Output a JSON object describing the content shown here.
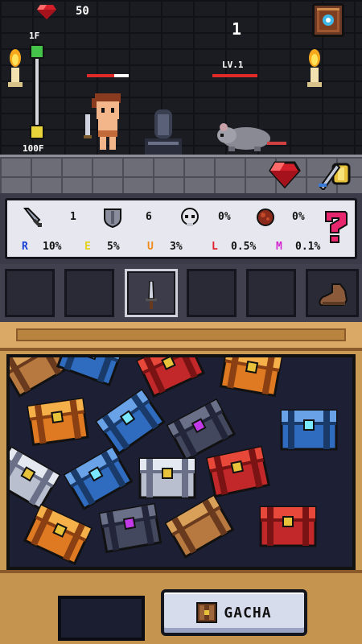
{
  "hud": {
    "gems": "50",
    "score": "1",
    "floor_top": "1F",
    "floor_bottom": "100F"
  },
  "enemy": {
    "level": "LV.1"
  },
  "stats": {
    "attack": "1",
    "defense": "6",
    "crit": "0%",
    "luck": "0%",
    "rarities": [
      {
        "letter": "R",
        "value": "10%",
        "color": "#1a3fd6"
      },
      {
        "letter": "E",
        "value": "5%",
        "color": "#e4d21a"
      },
      {
        "letter": "U",
        "value": "3%",
        "color": "#f08a1a"
      },
      {
        "letter": "L",
        "value": "0.5%",
        "color": "#e0202a"
      },
      {
        "letter": "M",
        "value": "0.1%",
        "color": "#d426d0"
      }
    ]
  },
  "gacha": {
    "button_label": "GACHA"
  },
  "icons": {
    "gem": "ruby-gem-icon",
    "spellbook": "spellbook-icon",
    "sword": "sword-icon",
    "shield": "shield-icon",
    "skull": "skull-icon",
    "meat": "meat-icon",
    "help": "question-mark-icon",
    "chest": "treasure-chest-icon"
  }
}
